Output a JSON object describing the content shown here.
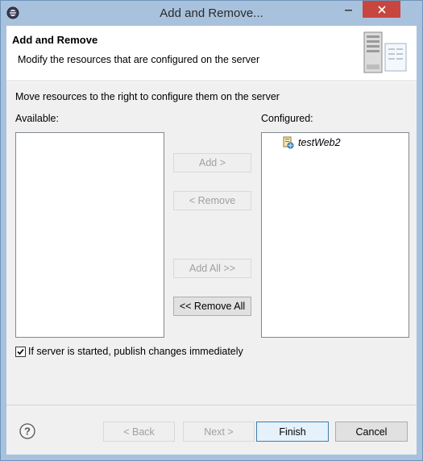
{
  "window": {
    "title": "Add and Remove..."
  },
  "header": {
    "title": "Add and Remove",
    "description": "Modify the resources that are configured on the server"
  },
  "body": {
    "instruction": "Move resources to the right to configure them on the server",
    "available_label": "Available:",
    "configured_label": "Configured:",
    "available_items": [],
    "configured_items": [
      {
        "label": "testWeb2"
      }
    ]
  },
  "buttons": {
    "add": "Add >",
    "remove": "< Remove",
    "add_all": "Add All >>",
    "remove_all": "<< Remove All"
  },
  "options": {
    "publish_immediately_label": "If server is started, publish changes immediately",
    "publish_immediately_checked": true
  },
  "footer": {
    "back": "< Back",
    "next": "Next >",
    "finish": "Finish",
    "cancel": "Cancel"
  },
  "colors": {
    "title_bar": "#a8c2dd",
    "close_button": "#c7463f",
    "default_button_border": "#3c7fb1"
  }
}
